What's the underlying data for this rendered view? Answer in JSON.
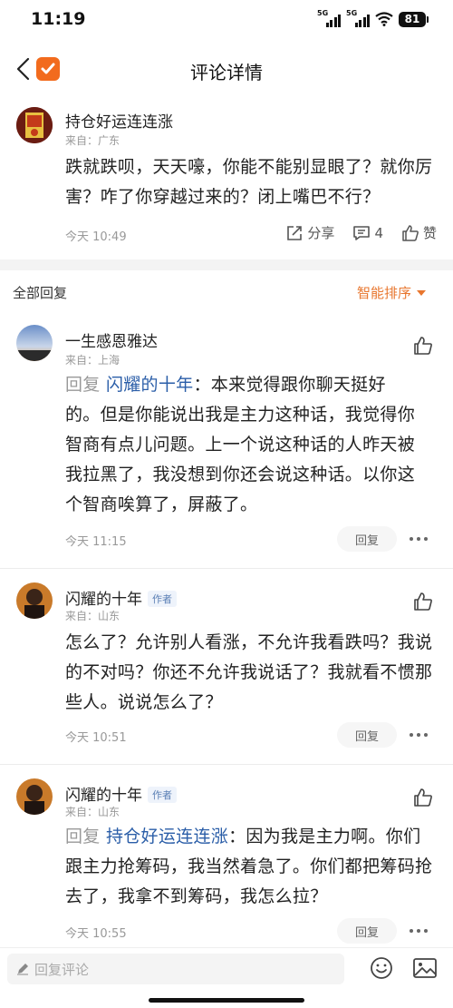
{
  "status_bar": {
    "time": "11:19",
    "signal1": "5G",
    "signal2": "5G",
    "battery": "81"
  },
  "nav": {
    "title": "评论详情",
    "back_icon": "chevron-left-icon",
    "logo_icon": "app-logo-icon"
  },
  "post": {
    "username": "持仓好运连连涨",
    "location": "来自：广东",
    "text": "跌就跌呗，天天嚎，你能不能别显眼了？就你厉害？咋了你穿越过来的？闭上嘴巴不行？",
    "time": "今天 10:49",
    "share_label": "分享",
    "comment_count": "4",
    "like_label": "赞"
  },
  "replies_header": {
    "title": "全部回复",
    "sort_label": "智能排序"
  },
  "replies": [
    {
      "username": "一生感恩雅达",
      "location": "来自：上海",
      "reply_prefix": "回复 ",
      "reply_target": "闪耀的十年",
      "text": "：本来觉得跟你聊天挺好的。但是你能说出我是主力这种话，我觉得你智商有点儿问题。上一个说这种话的人昨天被我拉黑了，我没想到你还会说这种话。以你这个智商唉算了，屏蔽了。",
      "time": "今天 11:15",
      "reply_button": "回复",
      "author_badge": ""
    },
    {
      "username": "闪耀的十年",
      "location": "来自：山东",
      "reply_prefix": "",
      "reply_target": "",
      "text": "怎么了？允许别人看涨，不允许我看跌吗？我说的不对吗？你还不允许我说话了？我就看不惯那些人。说说怎么了？",
      "time": "今天 10:51",
      "reply_button": "回复",
      "author_badge": "作者"
    },
    {
      "username": "闪耀的十年",
      "location": "来自：山东",
      "reply_prefix": "回复 ",
      "reply_target": "持仓好运连连涨",
      "text": "：因为我是主力啊。你们跟主力抢筹码，我当然着急了。你们都把筹码抢去了，我拿不到筹码，我怎么拉？",
      "time": "今天 10:55",
      "reply_button": "回复",
      "author_badge": "作者"
    }
  ],
  "bottom_bar": {
    "placeholder": "回复评论",
    "emoji_icon": "emoji-icon",
    "image_icon": "image-icon"
  },
  "colors": {
    "accent": "#e8762e",
    "link": "#2b5ea8",
    "muted": "#999999"
  }
}
